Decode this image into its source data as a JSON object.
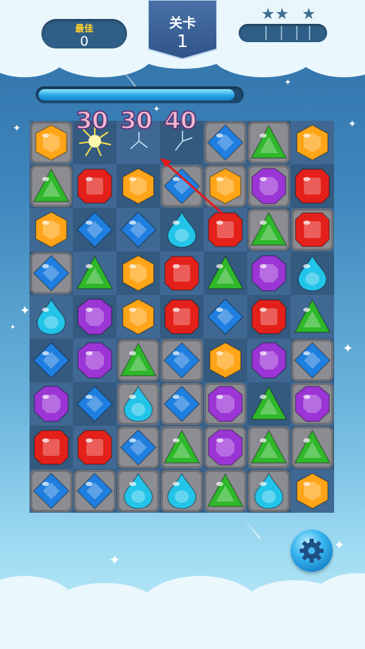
{
  "hud": {
    "best_label": "最佳",
    "best_value": "0",
    "level_label": "关卡",
    "level_value": "1",
    "stars_earned": 0,
    "stars_total": 3,
    "progress": 0.97
  },
  "floating_scores": [
    "30",
    "30",
    "40"
  ],
  "colors": {
    "gem_red": "#e3211a",
    "gem_orange": "#ffa517",
    "gem_green": "#2fb82a",
    "gem_blue": "#1f7fe0",
    "gem_cyan": "#23c4ea",
    "gem_purple": "#9b35d6",
    "banner": "#3a5f95",
    "hud_panel": "#2f5e86"
  },
  "board": {
    "rows": [
      [
        "orange-hex",
        "empty",
        "empty",
        "empty",
        "blue-diamond",
        "green-triangle",
        "orange-hex"
      ],
      [
        "green-triangle",
        "red-square",
        "orange-hex",
        "blue-diamond",
        "orange-hex",
        "purple-octagon",
        "red-square"
      ],
      [
        "orange-hex",
        "blue-diamond",
        "blue-diamond",
        "cyan-drop",
        "red-square",
        "green-triangle",
        "red-square"
      ],
      [
        "blue-diamond",
        "green-triangle",
        "orange-hex",
        "red-square",
        "green-triangle",
        "purple-octagon",
        "cyan-drop"
      ],
      [
        "cyan-drop",
        "purple-octagon",
        "orange-hex",
        "red-square",
        "blue-diamond",
        "red-square",
        "green-triangle"
      ],
      [
        "blue-diamond",
        "purple-octagon",
        "green-triangle",
        "blue-diamond",
        "orange-hex",
        "purple-octagon",
        "blue-diamond"
      ],
      [
        "purple-octagon",
        "blue-diamond",
        "cyan-drop",
        "blue-diamond",
        "purple-octagon",
        "green-triangle",
        "purple-octagon"
      ],
      [
        "red-square",
        "red-square",
        "blue-diamond",
        "green-triangle",
        "purple-octagon",
        "green-triangle",
        "green-triangle"
      ],
      [
        "blue-diamond",
        "blue-diamond",
        "cyan-drop",
        "cyan-drop",
        "green-triangle",
        "cyan-drop",
        "orange-hex"
      ]
    ],
    "stone_tiles": [
      [
        true,
        false,
        false,
        false,
        true,
        true,
        false
      ],
      [
        true,
        false,
        false,
        true,
        true,
        true,
        false
      ],
      [
        false,
        false,
        false,
        false,
        false,
        true,
        true
      ],
      [
        true,
        false,
        false,
        false,
        false,
        false,
        false
      ],
      [
        false,
        false,
        false,
        false,
        false,
        false,
        false
      ],
      [
        false,
        false,
        true,
        true,
        false,
        false,
        true
      ],
      [
        false,
        false,
        true,
        true,
        true,
        false,
        true
      ],
      [
        false,
        false,
        true,
        true,
        true,
        true,
        true
      ],
      [
        true,
        true,
        true,
        true,
        true,
        true,
        false
      ]
    ]
  },
  "icons": {
    "settings": "gear-icon",
    "star": "star-icon",
    "hint": "hint-arrow-icon"
  }
}
